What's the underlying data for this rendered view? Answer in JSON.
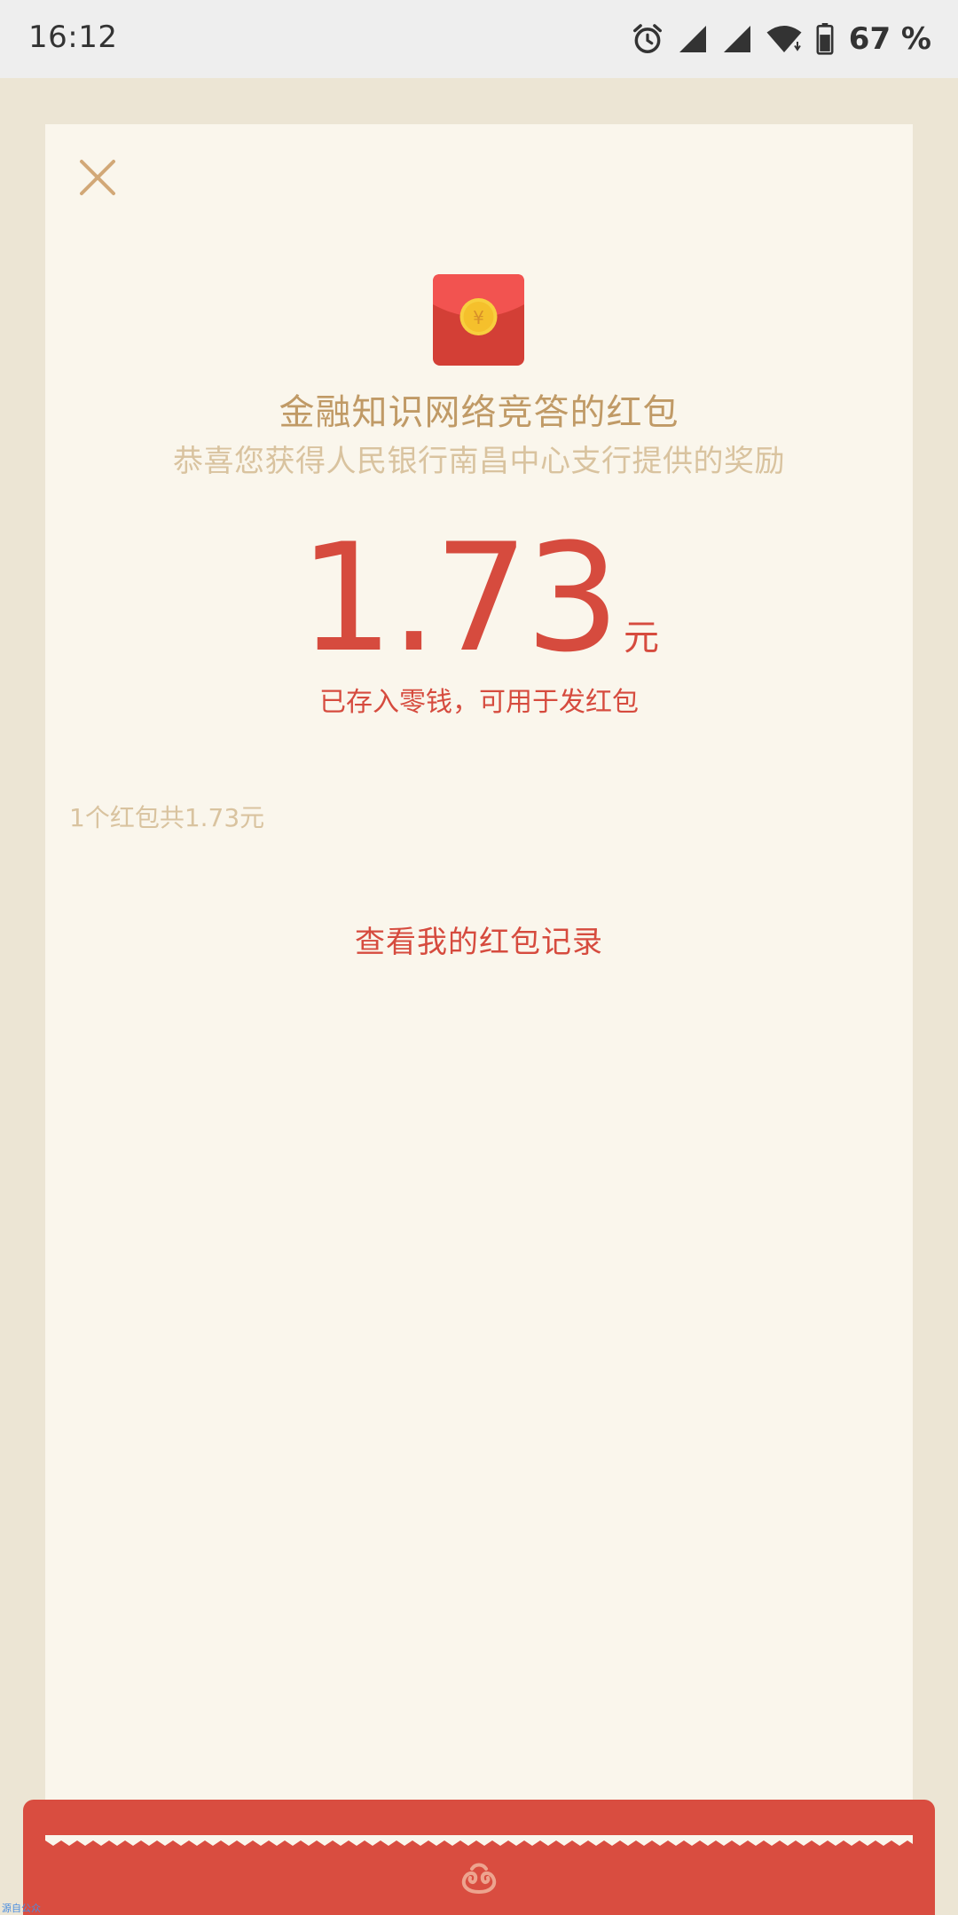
{
  "status_bar": {
    "time": "16:12",
    "battery_percent": "67 %",
    "icons": [
      "alarm-icon",
      "signal-icon",
      "signal-icon",
      "wifi-icon",
      "battery-icon"
    ]
  },
  "header": {
    "close_icon": "close-icon"
  },
  "red_packet": {
    "icon": "red-envelope-icon",
    "title": "金融知识网络竞答的红包",
    "subtitle": "恭喜您获得人民银行南昌中心支行提供的奖励",
    "amount": "1.73",
    "currency": "元",
    "stored_text": "已存入零钱，可用于发红包",
    "summary": "1个红包共1.73元",
    "records_link": "查看我的红包记录"
  },
  "footer": {
    "emblem_icon": "cloud-swirl-icon",
    "corner_text": "源自公众"
  },
  "colors": {
    "accent_red": "#d64b3e",
    "gold_text": "#c09a66",
    "light_gold_text": "#d9c39f",
    "card_bg": "#faf6ec",
    "page_bg": "#ece5d4"
  }
}
